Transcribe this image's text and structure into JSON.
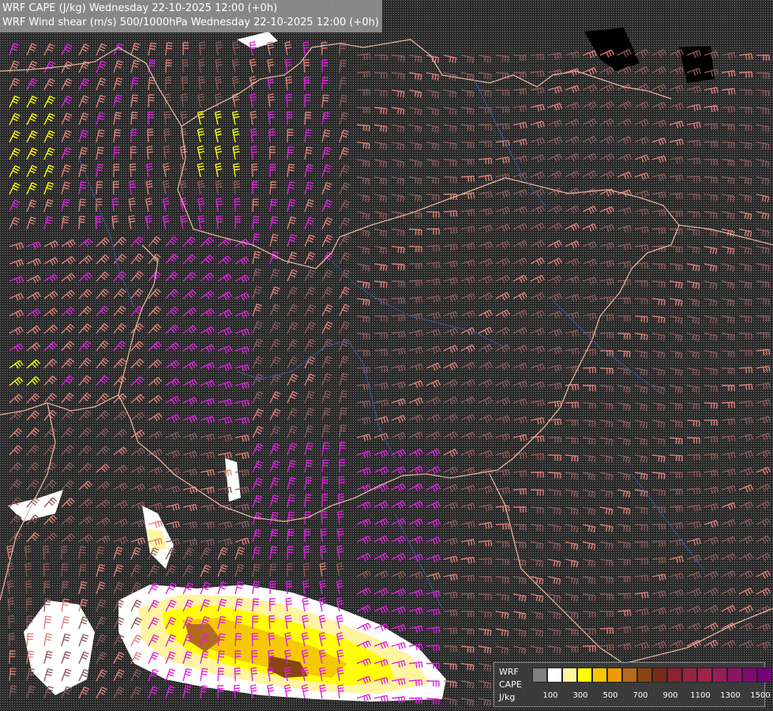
{
  "title": {
    "line1": "WRF CAPE (J/kg) Wednesday 22-10-2025 12:00 (+0h)",
    "line2": "WRF Wind shear (m/s) 500/1000hPa Wednesday 22-10-2025 12:00 (+0h)"
  },
  "legend": {
    "label1": "WRF",
    "label2": "CAPE",
    "label3": "J/kg",
    "ticks": [
      "100",
      "300",
      "500",
      "700",
      "900",
      "1100",
      "1300",
      "1500"
    ],
    "colors": [
      "#808080",
      "#ffffff",
      "#fff4a0",
      "#ffff00",
      "#f5c800",
      "#ee9a00",
      "#b46a1e",
      "#8b4513",
      "#7a2a1a",
      "#8b2332",
      "#962640",
      "#a0224c",
      "#981c5a",
      "#8c1464",
      "#800a6e",
      "#780078"
    ]
  },
  "colors": {
    "background": "#000000",
    "barb_magenta": "#e020e0",
    "barb_salmon": "#e0807a",
    "barb_brown": "#8c5a5a",
    "barb_yellow": "#ffff00",
    "border_line": "#e6b49b",
    "river_line": "#3c5aa0"
  }
}
